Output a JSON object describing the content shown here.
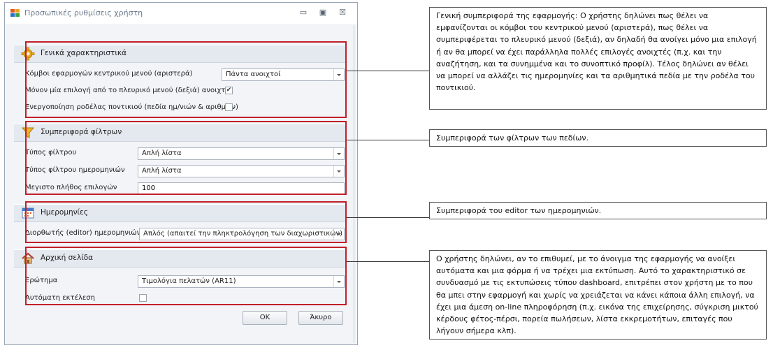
{
  "window": {
    "title": "Προσωπικές ρυθμίσεις χρήστη",
    "controls": {
      "minimize": "▭",
      "maximize": "▣",
      "close": "☒"
    }
  },
  "general": {
    "header": "Γενικά χαρακτηριστικά",
    "node_label": "Κόμβοι εφαρμογών κεντρικού μενού (αριστερά)",
    "node_value": "Πάντα ανοιχτοί",
    "single_option_label": "Μόνον μία επιλογή από το πλευρικό μενού (δεξιά) ανοιχτή",
    "single_option_checked": true,
    "wheel_label": "Ενεργοποίηση ροδέλας ποντικιού (πεδία ημ/νιών & αριθμών)",
    "wheel_checked": false
  },
  "filters": {
    "header": "Συμπεριφορά φίλτρων",
    "type_label": "Τύπος φίλτρου",
    "type_value": "Απλή λίστα",
    "date_type_label": "Τύπος φίλτρου ημερομηνιών",
    "date_type_value": "Απλή λίστα",
    "max_label": "Μεγιστο πλήθος επιλογών",
    "max_value": "100"
  },
  "dates": {
    "header": "Ημερομηνίες",
    "editor_label": "Διορθωτής (editor) ημερομηνιών",
    "editor_value": "Απλός (απαιτεί την πληκτρολόγηση των διαχωριστικών)"
  },
  "home": {
    "header": "Αρχική σελίδα",
    "query_label": "Ερώτημα",
    "query_value": "Τιμολόγια πελατών (AR11)",
    "autorun_label": "Αυτόματη εκτέλεση",
    "autorun_checked": false
  },
  "buttons": {
    "ok": "OK",
    "cancel": "Άκυρο"
  },
  "callouts": {
    "general": "Γενική συμπεριφορά της εφαρμογής: Ο χρήστης δηλώνει πως θέλει να εμφανίζονται οι κόμβοι του κεντρικού μενού (αριστερά), πως θέλει να συμπεριφέρεται το πλευρικό μενού (δεξιά), αν δηλαδή θα ανοίγει μόνο μια επιλογή ή αν θα μπορεί να έχει παράλληλα πολλές επιλογές ανοιχτές (π.χ. και την αναζήτηση, και τα συνημμένα και το συνοπτικό προφίλ). Τέλος δηλώνει αν θέλει να μπορεί να αλλάζει τις ημερομηνίες και τα αριθμητικά πεδία με την ροδέλα του ποντικιού.",
    "filters": "Συμπεριφορά των φίλτρων των πεδίων.",
    "dates": "Συμπεριφορά του editor των ημερομηνιών.",
    "home": "Ο χρήστης δηλώνει, αν το επιθυμεί, με το άνοιγμα της εφαρμογής να ανοίξει αυτόματα και μια φόρμα ή να τρέχει μια εκτύπωση. Αυτό το χαρακτηριστικό σε συνδυασμό με τις εκτυπώσεις τύπου dashboard, επιτρέπει στον χρήστη με το που θα μπει στην εφαρμογή και χωρίς να χρειάζεται να κάνει κάποια άλλη επιλογή, να έχει μια άμεση on-line πληροφόρηση (π.χ. εικόνα της επιχείρησης, σύγκριση μικτού κέρδους φέτος-πέρσι, πορεία πωλήσεων, λίστα εκκρεμοτήτων, επιταγές που λήγουν σήμερα κλπ)."
  },
  "colors": {
    "highlight": "#c0202a",
    "header_bg": "#e4e8ef",
    "window_bg": "#f2f4f8"
  }
}
